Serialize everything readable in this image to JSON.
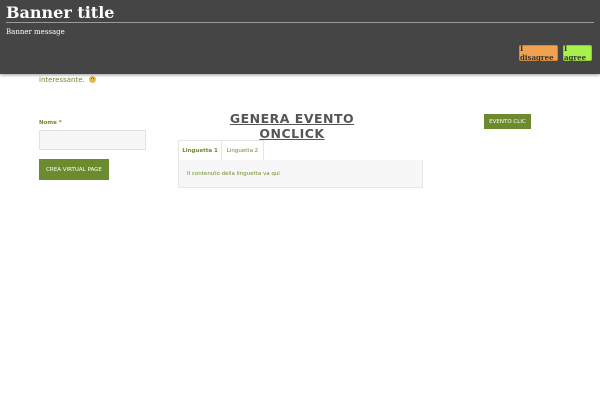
{
  "banner": {
    "title": "Banner title",
    "message": "Banner message",
    "disagree_label": "I disagree",
    "agree_label": "I agree"
  },
  "intro": {
    "text": "interessante."
  },
  "form": {
    "name_label": "Nome",
    "required_mark": "*",
    "name_value": "",
    "submit_label": "CREA VIRTUAL PAGE"
  },
  "event": {
    "title": "GENERA EVENTO ONCLICK",
    "button_label": "EVENTO CLIC"
  },
  "tabs": {
    "items": [
      {
        "label": "Linguetta 1",
        "active": true
      },
      {
        "label": "Linguetta 2",
        "active": false
      }
    ],
    "panel_text": "Il contenuto della linguetta va qui"
  },
  "colors": {
    "banner_bg": "#454545",
    "disagree_bg": "#f1a24f",
    "agree_bg": "#a8f04a",
    "accent_green": "#6b8b2e",
    "text_green": "#6e8a2c"
  },
  "icons": {
    "intro_emoji": "smiley-icon"
  }
}
